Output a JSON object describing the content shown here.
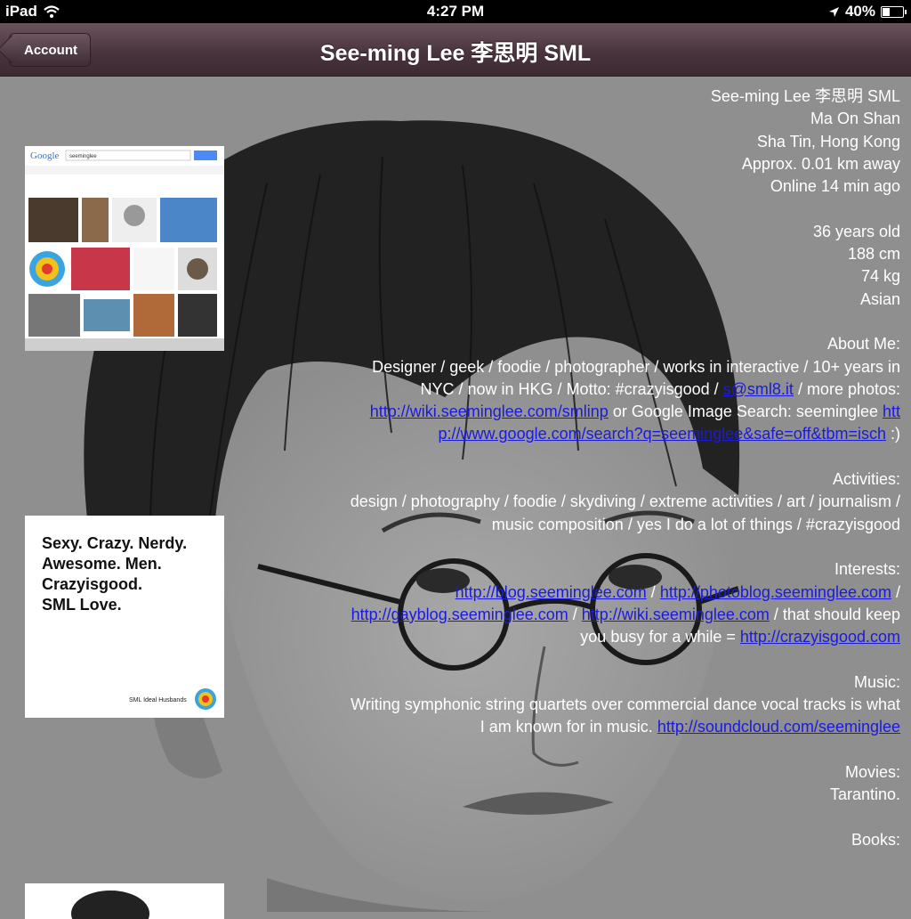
{
  "status_bar": {
    "device": "iPad",
    "time": "4:27 PM",
    "battery": "40%",
    "battery_level": 0.4
  },
  "nav": {
    "back_label": "Account",
    "title": "See-ming Lee 李思明 SML"
  },
  "tiles": {
    "google_logo": "Google",
    "google_query": "seeminglee",
    "slogan": "Sexy. Crazy. Nerdy.\nAwesome. Men.\nCrazyisgood.\nSML Love.",
    "slogan_small": "SML Ideal Husbands"
  },
  "profile": {
    "name": "See-ming Lee 李思明 SML",
    "location1": "Ma On Shan",
    "location2": "Sha Tin, Hong Kong",
    "distance": "Approx. 0.01 km away",
    "online": "Online 14 min ago",
    "age": "36 years old",
    "height": "188 cm",
    "weight": "74 kg",
    "ethnicity": "Asian"
  },
  "about": {
    "heading": "About Me:",
    "text1": "Designer / geek / foodie / photographer / works in interactive / 10+ years in NYC / now in HKG / Motto: #crazyisgood / ",
    "email": "s@sml8.it",
    "text2": " / more photos: ",
    "link1": "http://wiki.seeminglee.com/smlinp",
    "text3": " or Google Image Search: seeminglee ",
    "link2": "http://www.google.com/search?q=seeminglee&safe=off&tbm=isch",
    "text4": " :)"
  },
  "activities": {
    "heading": "Activities:",
    "text": "design / photography / foodie / skydiving / extreme activities / art / journalism / music composition / yes I do a lot of things / #crazyisgood"
  },
  "interests": {
    "heading": "Interests:",
    "link1": "http://blog.seeminglee.com",
    "link2": "http://photoblog.seeminglee.com",
    "link3": "http://gayblog.seeminglee.com",
    "link4": "http://wiki.seeminglee.com",
    "text": " / that should keep you busy for a while = ",
    "link5": "http://crazyisgood.com"
  },
  "music": {
    "heading": "Music:",
    "text": "Writing symphonic string quartets over commercial dance vocal tracks is what I am known for in music. ",
    "link": "http://soundcloud.com/seeminglee"
  },
  "movies": {
    "heading": "Movies:",
    "text": "Tarantino."
  },
  "books": {
    "heading": "Books:"
  }
}
